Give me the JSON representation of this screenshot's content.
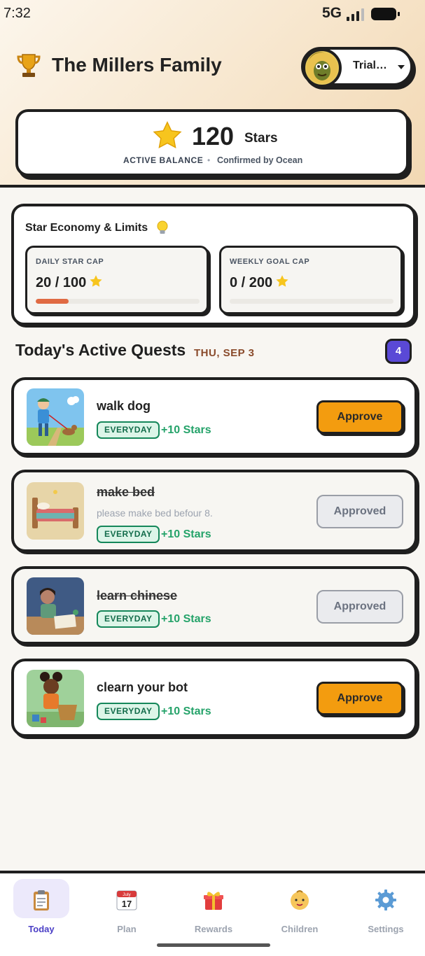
{
  "status_bar": {
    "time": "7:32",
    "network": "5G"
  },
  "header": {
    "family_title": "The Millers Family",
    "profile_name": "Trial…",
    "icons": {
      "trophy": "trophy-icon",
      "caret": "chevron-down-icon"
    }
  },
  "balance": {
    "value": "120",
    "unit": "Stars",
    "label": "ACTIVE BALANCE",
    "separator": "•",
    "confirmed_by": "Confirmed by Ocean"
  },
  "economy": {
    "title": "Star Economy & Limits",
    "daily": {
      "label": "DAILY STAR CAP",
      "value": "20 / 100",
      "progress": 0.2,
      "color": "#e06a43"
    },
    "weekly": {
      "label": "WEEKLY GOAL CAP",
      "value": "0 / 200",
      "progress": 0.0,
      "color": "#e06a43"
    }
  },
  "quests": {
    "title": "Today's Active Quests",
    "date": "THU, SEP 3",
    "count": "4",
    "items": [
      {
        "name": "walk dog",
        "description": "",
        "tag": "EVERYDAY",
        "reward": "+10 Stars",
        "action": "Approve",
        "state": "pending"
      },
      {
        "name": "make bed",
        "description": "please make bed befour 8.",
        "tag": "EVERYDAY",
        "reward": "+10 Stars",
        "action": "Approved",
        "state": "approved"
      },
      {
        "name": "learn chinese",
        "description": "",
        "tag": "EVERYDAY",
        "reward": "+10 Stars",
        "action": "Approved",
        "state": "approved"
      },
      {
        "name": "clearn your bot",
        "description": "",
        "tag": "EVERYDAY",
        "reward": "+10 Stars",
        "action": "Approve",
        "state": "pending"
      }
    ]
  },
  "tabs": [
    {
      "label": "Today",
      "icon": "clipboard-icon",
      "active": true
    },
    {
      "label": "Plan",
      "icon": "calendar-icon",
      "active": false,
      "icon_text": "17",
      "icon_month": "July"
    },
    {
      "label": "Rewards",
      "icon": "gift-icon",
      "active": false
    },
    {
      "label": "Children",
      "icon": "baby-icon",
      "active": false
    },
    {
      "label": "Settings",
      "icon": "gear-icon",
      "active": false
    }
  ],
  "colors": {
    "accent": "#5a49d6",
    "approve": "#f39c0f",
    "reward_green": "#25a36a",
    "date_brown": "#8a4b2c"
  }
}
